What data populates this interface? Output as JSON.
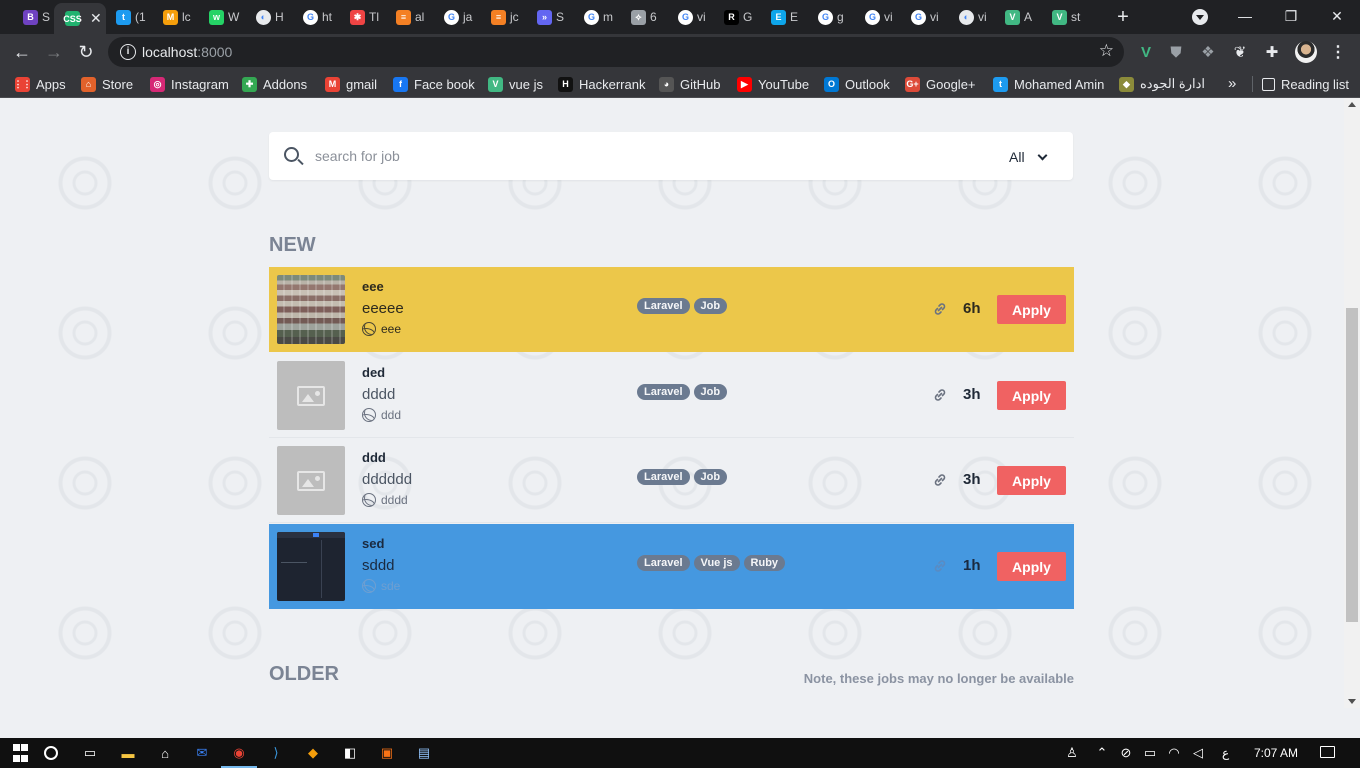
{
  "browser": {
    "tabs": [
      {
        "label": "S",
        "icon": "b-icon",
        "color": "#6f42c1",
        "glyph": "B"
      },
      {
        "label": "",
        "icon": "css-icon",
        "color": "#21b26f",
        "glyph": "CSS",
        "active": true
      },
      {
        "label": "(1",
        "icon": "twitter-icon",
        "color": "#1d9bf0",
        "glyph": "t"
      },
      {
        "label": "lc",
        "icon": "moodle-icon",
        "color": "#f59e0b",
        "glyph": "M"
      },
      {
        "label": "W",
        "icon": "whatsapp-icon",
        "color": "#25d366",
        "glyph": "w"
      },
      {
        "label": "H",
        "icon": "globe-icon",
        "color": "#e8eaed",
        "glyph": "◐"
      },
      {
        "label": "ht",
        "icon": "google-icon",
        "color": "#ffffff",
        "glyph": "G"
      },
      {
        "label": "Tl",
        "icon": "asterisk-icon",
        "color": "#ef4444",
        "glyph": "✱"
      },
      {
        "label": "al",
        "icon": "stackoverflow-icon",
        "color": "#f48024",
        "glyph": "≡"
      },
      {
        "label": "ja",
        "icon": "google-icon",
        "color": "#ffffff",
        "glyph": "G"
      },
      {
        "label": "jc",
        "icon": "stackoverflow-icon",
        "color": "#f48024",
        "glyph": "≡"
      },
      {
        "label": "S",
        "icon": "shortcut-icon",
        "color": "#6366f1",
        "glyph": "»"
      },
      {
        "label": "m",
        "icon": "google-icon",
        "color": "#ffffff",
        "glyph": "G"
      },
      {
        "label": "6",
        "icon": "arrow-icon",
        "color": "#9aa0a6",
        "glyph": "⟡"
      },
      {
        "label": "vi",
        "icon": "google-icon",
        "color": "#ffffff",
        "glyph": "G"
      },
      {
        "label": "G",
        "icon": "r-icon",
        "color": "#000000",
        "glyph": "R"
      },
      {
        "label": "E",
        "icon": "e-icon",
        "color": "#0ea5e9",
        "glyph": "E"
      },
      {
        "label": "g",
        "icon": "google-icon",
        "color": "#ffffff",
        "glyph": "G"
      },
      {
        "label": "vi",
        "icon": "google-icon",
        "color": "#ffffff",
        "glyph": "G"
      },
      {
        "label": "vi",
        "icon": "google-icon",
        "color": "#ffffff",
        "glyph": "G"
      },
      {
        "label": "vi",
        "icon": "globe-icon",
        "color": "#e8eaed",
        "glyph": "◐"
      },
      {
        "label": "A",
        "icon": "vue-icon",
        "color": "#41b883",
        "glyph": "V"
      },
      {
        "label": "st",
        "icon": "vue-icon",
        "color": "#41b883",
        "glyph": "V"
      }
    ],
    "url_host": "localhost",
    "url_port": ":8000",
    "bookmarks": [
      {
        "label": "Apps",
        "icon": "apps-grid-icon",
        "color": "#ea4335",
        "glyph": "⋮⋮"
      },
      {
        "label": "Store",
        "icon": "store-icon",
        "color": "#e2622b",
        "glyph": "⌂"
      },
      {
        "label": "Instagram",
        "icon": "instagram-icon",
        "color": "#d62976",
        "glyph": "◎"
      },
      {
        "label": "Addons",
        "icon": "puzzle-icon",
        "color": "#34a853",
        "glyph": "✚"
      },
      {
        "label": "gmail",
        "icon": "gmail-icon",
        "color": "#ea4335",
        "glyph": "M"
      },
      {
        "label": "Face book",
        "icon": "facebook-icon",
        "color": "#1877f2",
        "glyph": "f"
      },
      {
        "label": "vue js",
        "icon": "vue-icon",
        "color": "#41b883",
        "glyph": "V"
      },
      {
        "label": "Hackerrank",
        "icon": "hackerrank-icon",
        "color": "#111111",
        "glyph": "H"
      },
      {
        "label": "GitHub",
        "icon": "github-icon",
        "color": "#555555",
        "glyph": "◕"
      },
      {
        "label": "YouTube",
        "icon": "youtube-icon",
        "color": "#ff0000",
        "glyph": "▶"
      },
      {
        "label": "Outlook",
        "icon": "outlook-icon",
        "color": "#0078d4",
        "glyph": "O"
      },
      {
        "label": "Google+",
        "icon": "googleplus-icon",
        "color": "#dd4b39",
        "glyph": "G+"
      },
      {
        "label": "Mohamed Amin",
        "icon": "twitter-icon",
        "color": "#1d9bf0",
        "glyph": "t"
      },
      {
        "label": "ادارة الجوده",
        "icon": "quality-icon",
        "color": "#8b8b3a",
        "glyph": "◆"
      }
    ],
    "reading_list": "Reading list"
  },
  "search": {
    "placeholder": "search for job",
    "filter_value": "All"
  },
  "sections": {
    "new_title": "NEW",
    "older_title": "OLDER",
    "older_note": "Note, these jobs may no longer be available"
  },
  "jobs": [
    {
      "company": "eee",
      "title": "eeeee",
      "meta": "eee",
      "tags": [
        "Laravel",
        "Job"
      ],
      "time": "6h",
      "apply": "Apply",
      "style": "featured",
      "thumb": "building"
    },
    {
      "company": "ded",
      "title": "dddd",
      "meta": "ddd",
      "tags": [
        "Laravel",
        "Job"
      ],
      "time": "3h",
      "apply": "Apply",
      "style": "plain",
      "thumb": "placeholder"
    },
    {
      "company": "ddd",
      "title": "dddddd",
      "meta": "dddd",
      "tags": [
        "Laravel",
        "Job"
      ],
      "time": "3h",
      "apply": "Apply",
      "style": "plain",
      "thumb": "placeholder"
    },
    {
      "company": "sed",
      "title": "sddd",
      "meta": "sde",
      "tags": [
        "Laravel",
        "Vue js",
        "Ruby"
      ],
      "time": "1h",
      "apply": "Apply",
      "style": "highlight",
      "thumb": "dark"
    }
  ],
  "taskbar": {
    "language": "ع",
    "clock": "7:07 AM"
  }
}
